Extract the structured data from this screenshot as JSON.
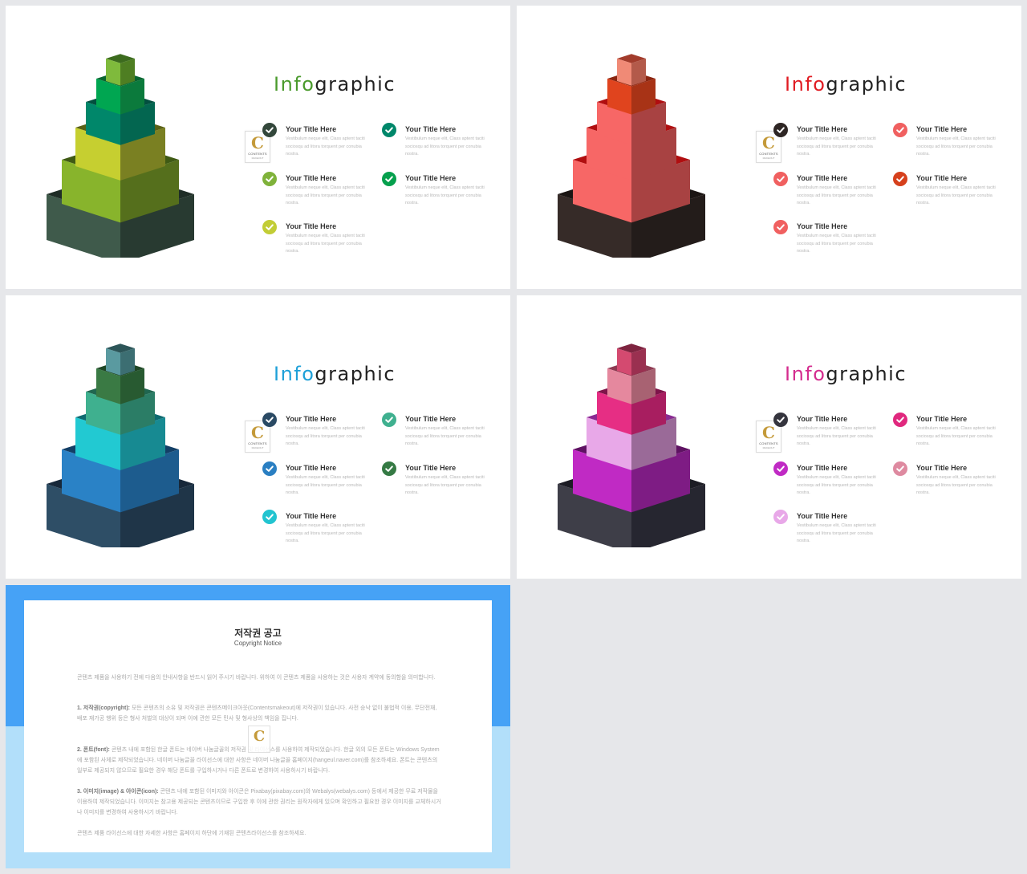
{
  "slides": [
    {
      "title_prefix": "Info",
      "title_suffix": "graphic",
      "accent": "#4a9a2c",
      "pyramid": {
        "tiers": [
          {
            "front": "#7fba3c",
            "side": "#4e7e22",
            "top": "#3c6b1e"
          },
          {
            "front": "#00a651",
            "side": "#0b7a3c",
            "top": "#086430"
          },
          {
            "front": "#00876a",
            "side": "#036650",
            "top": "#024f3f"
          },
          {
            "front": "#c6cf30",
            "side": "#7a8022",
            "top": "#5a6116"
          },
          {
            "front": "#88b42c",
            "side": "#556f1c",
            "top": "#3f5a14"
          }
        ],
        "base": {
          "front": "#3f5a4b",
          "side": "#283a31",
          "top": "#1f2d26"
        }
      },
      "items": [
        {
          "title": "Your Title Here",
          "body": "Vestibulum neque elit, Class aptent taciti sociosqu ad litora torquent per conubia nostra.",
          "color": "#33473b"
        },
        {
          "title": "Your Title Here",
          "body": "Vestibulum neque elit, Class aptent taciti sociosqu ad litora torquent per conubia nostra.",
          "color": "#00876a"
        },
        {
          "title": "Your Title Here",
          "body": "Vestibulum neque elit, Class aptent taciti sociosqu ad litora torquent per conubia nostra.",
          "color": "#7fb23a"
        },
        {
          "title": "Your Title Here",
          "body": "Vestibulum neque elit, Class aptent taciti sociosqu ad litora torquent per conubia nostra.",
          "color": "#06a04d"
        },
        {
          "title": "Your Title Here",
          "body": "Vestibulum neque elit, Class aptent taciti sociosqu ad litora torquent per conubia nostra.",
          "color": "#c2cd36"
        }
      ]
    },
    {
      "title_prefix": "Info",
      "title_suffix": "graphic",
      "accent": "#e01b22",
      "pyramid": {
        "tiers": [
          {
            "front": "#f08a76",
            "side": "#b35a4a",
            "top": "#a23c2c"
          },
          {
            "front": "#e0441e",
            "side": "#a83316",
            "top": "#8a2510"
          },
          {
            "front": "#f76766",
            "side": "#a84242",
            "top": "#b00e10"
          },
          {
            "front": "#f76766",
            "side": "#a84242",
            "top": "#b00e10"
          },
          {
            "front": "#f76766",
            "side": "#a84242",
            "top": "#b00e10"
          }
        ],
        "base": {
          "front": "#362b28",
          "side": "#231c1a",
          "top": "#1b1513"
        }
      },
      "items": [
        {
          "title": "Your Title Here",
          "body": "Vestibulum neque elit, Class aptent taciti sociosqu ad litora torquent per conubia nostra.",
          "color": "#2e2624"
        },
        {
          "title": "Your Title Here",
          "body": "Vestibulum neque elit, Class aptent taciti sociosqu ad litora torquent per conubia nostra.",
          "color": "#f06060"
        },
        {
          "title": "Your Title Here",
          "body": "Vestibulum neque elit, Class aptent taciti sociosqu ad litora torquent per conubia nostra.",
          "color": "#f06060"
        },
        {
          "title": "Your Title Here",
          "body": "Vestibulum neque elit, Class aptent taciti sociosqu ad litora torquent per conubia nostra.",
          "color": "#d6401c"
        },
        {
          "title": "Your Title Here",
          "body": "Vestibulum neque elit, Class aptent taciti sociosqu ad litora torquent per conubia nostra.",
          "color": "#f06060"
        }
      ]
    },
    {
      "title_prefix": "Info",
      "title_suffix": "graphic",
      "accent": "#1ea0d8",
      "pyramid": {
        "tiers": [
          {
            "front": "#5a9aa0",
            "side": "#3c6e72",
            "top": "#2c5558"
          },
          {
            "front": "#3a7a44",
            "side": "#285a31",
            "top": "#1e4625"
          },
          {
            "front": "#3fb08f",
            "side": "#2b7d66",
            "top": "#206650"
          },
          {
            "front": "#22c9d2",
            "side": "#178a92",
            "top": "#0f6a70"
          },
          {
            "front": "#2a82c6",
            "side": "#1d5c8e",
            "top": "#133f66"
          }
        ],
        "base": {
          "front": "#2e4e66",
          "side": "#1f3548",
          "top": "#17283a"
        }
      },
      "items": [
        {
          "title": "Your Title Here",
          "body": "Vestibulum neque elit, Class aptent taciti sociosqu ad litora torquent per conubia nostra.",
          "color": "#2a4a64"
        },
        {
          "title": "Your Title Here",
          "body": "Vestibulum neque elit, Class aptent taciti sociosqu ad litora torquent per conubia nostra.",
          "color": "#3fb08f"
        },
        {
          "title": "Your Title Here",
          "body": "Vestibulum neque elit, Class aptent taciti sociosqu ad litora torquent per conubia nostra.",
          "color": "#2a7fc2"
        },
        {
          "title": "Your Title Here",
          "body": "Vestibulum neque elit, Class aptent taciti sociosqu ad litora torquent per conubia nostra.",
          "color": "#357a44"
        },
        {
          "title": "Your Title Here",
          "body": "Vestibulum neque elit, Class aptent taciti sociosqu ad litora torquent per conubia nostra.",
          "color": "#22c4d0"
        }
      ]
    },
    {
      "title_prefix": "Info",
      "title_suffix": "graphic",
      "accent": "#d42c8e",
      "pyramid": {
        "tiers": [
          {
            "front": "#d44a70",
            "side": "#9a3050",
            "top": "#7e2440"
          },
          {
            "front": "#e5889e",
            "side": "#a86272",
            "top": "#8e3a52"
          },
          {
            "front": "#e62e84",
            "side": "#a81e60",
            "top": "#7e144a"
          },
          {
            "front": "#e8a8e8",
            "side": "#9a6a98",
            "top": "#8a2a92"
          },
          {
            "front": "#c02ac4",
            "side": "#7e1c84",
            "top": "#5e1262"
          }
        ],
        "base": {
          "front": "#3e3e48",
          "side": "#262630",
          "top": "#1c1c24"
        }
      },
      "items": [
        {
          "title": "Your Title Here",
          "body": "Vestibulum neque elit, Class aptent taciti sociosqu ad litora torquent per conubia nostra.",
          "color": "#35353e"
        },
        {
          "title": "Your Title Here",
          "body": "Vestibulum neque elit, Class aptent taciti sociosqu ad litora torquent per conubia nostra.",
          "color": "#e0287e"
        },
        {
          "title": "Your Title Here",
          "body": "Vestibulum neque elit, Class aptent taciti sociosqu ad litora torquent per conubia nostra.",
          "color": "#c02ac4"
        },
        {
          "title": "Your Title Here",
          "body": "Vestibulum neque elit, Class aptent taciti sociosqu ad litora torquent per conubia nostra.",
          "color": "#de8aa0"
        },
        {
          "title": "Your Title Here",
          "body": "Vestibulum neque elit, Class aptent taciti sociosqu ad litora torquent per conubia nostra.",
          "color": "#e8a8e8"
        }
      ]
    }
  ],
  "watermark": {
    "letter": "C",
    "label": "CONTENTS",
    "sub": "MAKEOUT"
  },
  "notice": {
    "title": "저작권 공고",
    "subtitle": "Copyright Notice",
    "intro": "콘텐츠 제품을 사용하기 전에 다음의 안내사항을 반드시 읽어 주시기 바랍니다. 위하여 이 콘텐츠 제품을 사용하는 것은 사용자 계약에 동의함을 의미합니다.",
    "sections": [
      {
        "heading": "1. 저작권(copyright):",
        "body": "모든 콘텐츠의 소유 및 저작권은 콘텐츠메이크아웃(Contentsmakeout)에 저작권이 있습니다. 사전 승낙 없이 불법적 이용, 무단전재, 배포 재가공 행위 등은 형사 처벌의 대상이 되며 이에 관한 모든 민사 및 형사상의 책임을 집니다."
      },
      {
        "heading": "2. 폰트(font):",
        "body": "콘텐츠 내에 포함된 한글 폰트는 네이버 나눔글꼴의 저작권 및 라이선스를 사용하여 제작되었습니다. 한글 외의 모든 폰트는 Windows System에 포함된 사체로 제작되었습니다. 네이버 나눔글꼴 라이선스에 대한 사항은 네이버 나눔글꼴 홈페이지(hangeul.naver.com)를 참조하세요. 폰트는 콘텐츠의 일부로 제공되지 않으므로 필요한 경우 해당 폰트를 구입하시거나 다른 폰트로 변경하여 사용하시기 바랍니다."
      },
      {
        "heading": "3. 이미지(image) & 아이콘(icon):",
        "body": "콘텐츠 내에 포함된 이미지와 아이콘은 Pixabay(pixabay.com)와 Webalys(webalys.com) 등에서 제공한 무료 저작물을 이용하여 제작되었습니다. 이미지는 참고용 제공되는 콘텐츠이므로 구입한 후 이에 관한 권리는 원작자에게 있으며 확인하고 필요한 경우 이미지를 교체하시거나 이미지를 변경하여 사용하시기 바랍니다."
      }
    ],
    "footer": "콘텐츠 제품 라이선스에 대한 자세한 사항은 홈페이지 하단에 기재된 콘텐츠라이선스를 참조하세요."
  }
}
